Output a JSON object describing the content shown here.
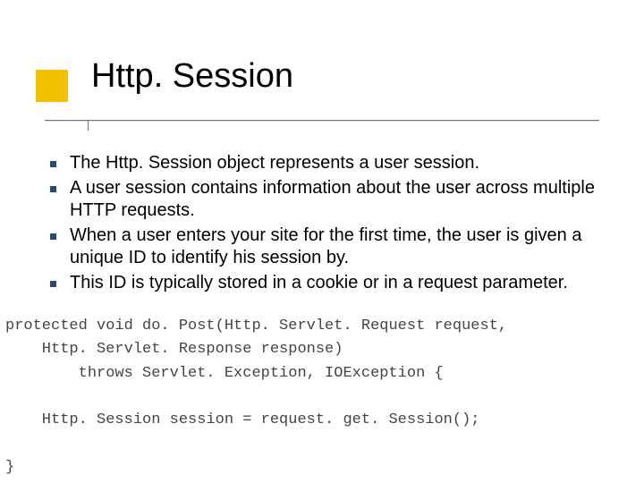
{
  "slide": {
    "title": "Http. Session",
    "bullets": [
      "The Http. Session object represents a user session.",
      "A user session contains information about the user across multiple HTTP requests.",
      "When a user enters your site for the first time, the user is given a unique ID to identify his session by.",
      "This ID is typically stored in a cookie or in a request parameter."
    ],
    "code": {
      "line1": "protected void do. Post(Http. Servlet. Request request,",
      "line2": "    Http. Servlet. Response response)",
      "line3": "        throws Servlet. Exception, IOException {",
      "line4": "",
      "line5": "    Http. Session session = request. get. Session();",
      "line6": "",
      "line7": "}"
    }
  }
}
